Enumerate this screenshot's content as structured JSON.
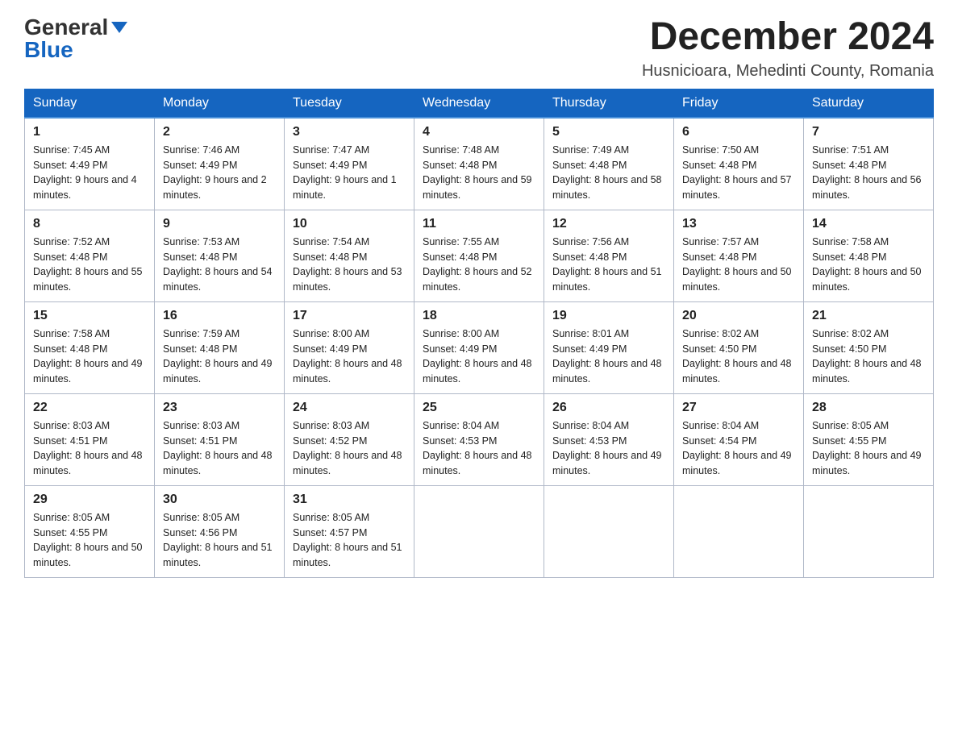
{
  "header": {
    "logo_general": "General",
    "logo_blue": "Blue",
    "month_title": "December 2024",
    "location": "Husnicioara, Mehedinti County, Romania"
  },
  "days_of_week": [
    "Sunday",
    "Monday",
    "Tuesday",
    "Wednesday",
    "Thursday",
    "Friday",
    "Saturday"
  ],
  "weeks": [
    [
      {
        "day": "1",
        "sunrise": "7:45 AM",
        "sunset": "4:49 PM",
        "daylight": "9 hours and 4 minutes."
      },
      {
        "day": "2",
        "sunrise": "7:46 AM",
        "sunset": "4:49 PM",
        "daylight": "9 hours and 2 minutes."
      },
      {
        "day": "3",
        "sunrise": "7:47 AM",
        "sunset": "4:49 PM",
        "daylight": "9 hours and 1 minute."
      },
      {
        "day": "4",
        "sunrise": "7:48 AM",
        "sunset": "4:48 PM",
        "daylight": "8 hours and 59 minutes."
      },
      {
        "day": "5",
        "sunrise": "7:49 AM",
        "sunset": "4:48 PM",
        "daylight": "8 hours and 58 minutes."
      },
      {
        "day": "6",
        "sunrise": "7:50 AM",
        "sunset": "4:48 PM",
        "daylight": "8 hours and 57 minutes."
      },
      {
        "day": "7",
        "sunrise": "7:51 AM",
        "sunset": "4:48 PM",
        "daylight": "8 hours and 56 minutes."
      }
    ],
    [
      {
        "day": "8",
        "sunrise": "7:52 AM",
        "sunset": "4:48 PM",
        "daylight": "8 hours and 55 minutes."
      },
      {
        "day": "9",
        "sunrise": "7:53 AM",
        "sunset": "4:48 PM",
        "daylight": "8 hours and 54 minutes."
      },
      {
        "day": "10",
        "sunrise": "7:54 AM",
        "sunset": "4:48 PM",
        "daylight": "8 hours and 53 minutes."
      },
      {
        "day": "11",
        "sunrise": "7:55 AM",
        "sunset": "4:48 PM",
        "daylight": "8 hours and 52 minutes."
      },
      {
        "day": "12",
        "sunrise": "7:56 AM",
        "sunset": "4:48 PM",
        "daylight": "8 hours and 51 minutes."
      },
      {
        "day": "13",
        "sunrise": "7:57 AM",
        "sunset": "4:48 PM",
        "daylight": "8 hours and 50 minutes."
      },
      {
        "day": "14",
        "sunrise": "7:58 AM",
        "sunset": "4:48 PM",
        "daylight": "8 hours and 50 minutes."
      }
    ],
    [
      {
        "day": "15",
        "sunrise": "7:58 AM",
        "sunset": "4:48 PM",
        "daylight": "8 hours and 49 minutes."
      },
      {
        "day": "16",
        "sunrise": "7:59 AM",
        "sunset": "4:48 PM",
        "daylight": "8 hours and 49 minutes."
      },
      {
        "day": "17",
        "sunrise": "8:00 AM",
        "sunset": "4:49 PM",
        "daylight": "8 hours and 48 minutes."
      },
      {
        "day": "18",
        "sunrise": "8:00 AM",
        "sunset": "4:49 PM",
        "daylight": "8 hours and 48 minutes."
      },
      {
        "day": "19",
        "sunrise": "8:01 AM",
        "sunset": "4:49 PM",
        "daylight": "8 hours and 48 minutes."
      },
      {
        "day": "20",
        "sunrise": "8:02 AM",
        "sunset": "4:50 PM",
        "daylight": "8 hours and 48 minutes."
      },
      {
        "day": "21",
        "sunrise": "8:02 AM",
        "sunset": "4:50 PM",
        "daylight": "8 hours and 48 minutes."
      }
    ],
    [
      {
        "day": "22",
        "sunrise": "8:03 AM",
        "sunset": "4:51 PM",
        "daylight": "8 hours and 48 minutes."
      },
      {
        "day": "23",
        "sunrise": "8:03 AM",
        "sunset": "4:51 PM",
        "daylight": "8 hours and 48 minutes."
      },
      {
        "day": "24",
        "sunrise": "8:03 AM",
        "sunset": "4:52 PM",
        "daylight": "8 hours and 48 minutes."
      },
      {
        "day": "25",
        "sunrise": "8:04 AM",
        "sunset": "4:53 PM",
        "daylight": "8 hours and 48 minutes."
      },
      {
        "day": "26",
        "sunrise": "8:04 AM",
        "sunset": "4:53 PM",
        "daylight": "8 hours and 49 minutes."
      },
      {
        "day": "27",
        "sunrise": "8:04 AM",
        "sunset": "4:54 PM",
        "daylight": "8 hours and 49 minutes."
      },
      {
        "day": "28",
        "sunrise": "8:05 AM",
        "sunset": "4:55 PM",
        "daylight": "8 hours and 49 minutes."
      }
    ],
    [
      {
        "day": "29",
        "sunrise": "8:05 AM",
        "sunset": "4:55 PM",
        "daylight": "8 hours and 50 minutes."
      },
      {
        "day": "30",
        "sunrise": "8:05 AM",
        "sunset": "4:56 PM",
        "daylight": "8 hours and 51 minutes."
      },
      {
        "day": "31",
        "sunrise": "8:05 AM",
        "sunset": "4:57 PM",
        "daylight": "8 hours and 51 minutes."
      },
      null,
      null,
      null,
      null
    ]
  ]
}
